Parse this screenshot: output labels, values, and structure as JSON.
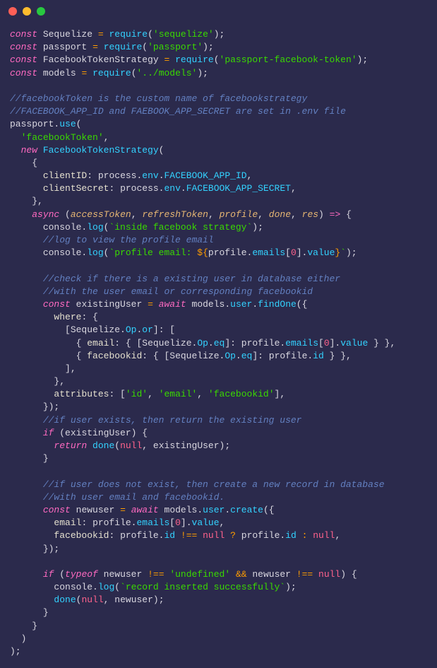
{
  "titlebar": {
    "buttons": [
      "close",
      "minimize",
      "zoom"
    ]
  },
  "code": {
    "l1": {
      "kw": "const",
      "id": "Sequelize",
      "fn": "require",
      "str": "'sequelize'"
    },
    "l2": {
      "kw": "const",
      "id": "passport",
      "fn": "require",
      "str": "'passport'"
    },
    "l3": {
      "kw": "const",
      "id": "FacebookTokenStrategy",
      "fn": "require",
      "str": "'passport-facebook-token'"
    },
    "l4": {
      "kw": "const",
      "id": "models",
      "fn": "require",
      "str": "'../models'"
    },
    "c1": "//facebookToken is the custom name of facebookstrategy",
    "c2": "//FACEBOOK_APP_ID and FAEBOOK_APP_SECRET are set in .env file",
    "l5": {
      "id": "passport",
      "fn": "use"
    },
    "l6": {
      "str": "'facebookToken'"
    },
    "l7": {
      "kw": "new",
      "fn": "FacebookTokenStrategy"
    },
    "l8a": {
      "prop": "clientID",
      "id1": "process",
      "id2": "env",
      "id3": "FACEBOOK_APP_ID"
    },
    "l8b": {
      "prop": "clientSecret",
      "id1": "process",
      "id2": "env",
      "id3": "FACEBOOK_APP_SECRET"
    },
    "l9": {
      "kw": "async",
      "p1": "accessToken",
      "p2": "refreshToken",
      "p3": "profile",
      "p4": "done",
      "p5": "res"
    },
    "l10": {
      "id": "console",
      "fn": "log",
      "str": "`inside facebook strategy`"
    },
    "c3": "//log to view the profile email",
    "l11": {
      "id": "console",
      "fn": "log",
      "s1": "`profile email: ",
      "s2": "${",
      "id2": "profile",
      "prop": "emails",
      "num": "0",
      "prop2": "value",
      "s3": "}",
      "s4": "`"
    },
    "c4": "//check if there is a existing user in database either",
    "c5": "//with the user email or corresponding facebookid",
    "l12": {
      "kw": "const",
      "id": "existingUser",
      "kw2": "await",
      "id2": "models",
      "prop": "user",
      "fn": "findOne"
    },
    "l13": {
      "prop": "where"
    },
    "l14": {
      "id": "Sequelize",
      "prop": "Op",
      "prop2": "or"
    },
    "l15": {
      "prop": "email",
      "id": "Sequelize",
      "prop2": "Op",
      "prop3": "eq",
      "id2": "profile",
      "prop4": "emails",
      "num": "0",
      "prop5": "value"
    },
    "l16": {
      "prop": "facebookid",
      "id": "Sequelize",
      "prop2": "Op",
      "prop3": "eq",
      "id2": "profile",
      "prop4": "id"
    },
    "l17": {
      "prop": "attributes",
      "s1": "'id'",
      "s2": "'email'",
      "s3": "'facebookid'"
    },
    "c6": "//if user exists, then return the existing user",
    "l18": {
      "kw": "if",
      "id": "existingUser"
    },
    "l19": {
      "kw": "return",
      "fn": "done",
      "n": "null",
      "id": "existingUser"
    },
    "c7": "//if user does not exist, then create a new record in database",
    "c8": "//with user email and facebookid.",
    "l20": {
      "kw": "const",
      "id": "newuser",
      "kw2": "await",
      "id2": "models",
      "prop": "user",
      "fn": "create"
    },
    "l21": {
      "prop": "email",
      "id": "profile",
      "prop2": "emails",
      "num": "0",
      "prop3": "value"
    },
    "l22": {
      "prop": "facebookid",
      "id": "profile",
      "prop2": "id",
      "n": "null",
      "id2": "profile",
      "prop3": "id",
      "n2": "null"
    },
    "l23": {
      "kw": "if",
      "kw2": "typeof",
      "id": "newuser",
      "s": "'undefined'",
      "id2": "newuser",
      "n": "null"
    },
    "l24": {
      "id": "console",
      "fn": "log",
      "str": "`record inserted successfully`"
    },
    "l25": {
      "fn": "done",
      "n": "null",
      "id": "newuser"
    }
  }
}
